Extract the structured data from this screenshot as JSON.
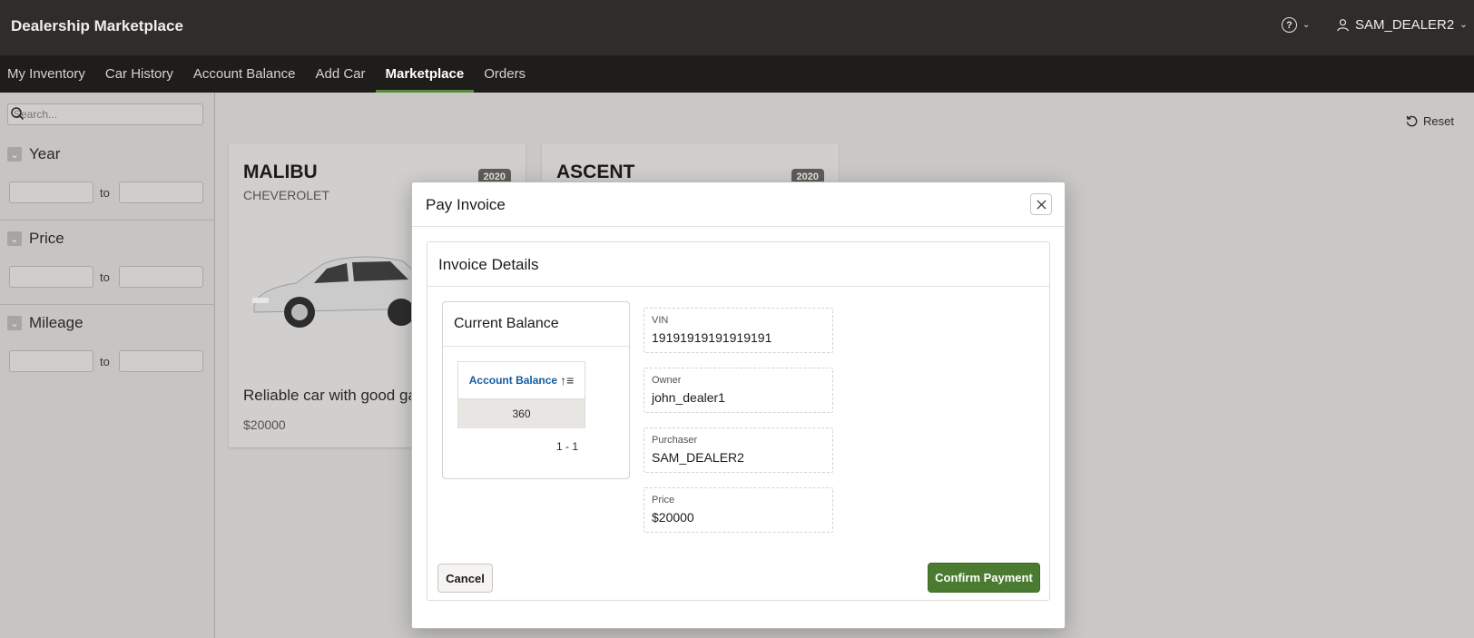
{
  "header": {
    "app_title": "Dealership Marketplace",
    "help_icon": "help-circle-icon",
    "user_icon": "user-icon",
    "username": "SAM_DEALER2"
  },
  "nav": {
    "items": [
      {
        "label": "My Inventory",
        "active": false
      },
      {
        "label": "Car History",
        "active": false
      },
      {
        "label": "Account Balance",
        "active": false
      },
      {
        "label": "Add Car",
        "active": false
      },
      {
        "label": "Marketplace",
        "active": true
      },
      {
        "label": "Orders",
        "active": false
      }
    ],
    "active_color": "#5a8a3c"
  },
  "sidebar": {
    "search_placeholder": "Search...",
    "filters": [
      {
        "label": "Year",
        "to": "to"
      },
      {
        "label": "Price",
        "to": "to"
      },
      {
        "label": "Mileage",
        "to": "to"
      }
    ]
  },
  "main": {
    "reset_label": "Reset",
    "cards": [
      {
        "model": "MALIBU",
        "make": "CHEVEROLET",
        "year": "2020",
        "description": "Reliable car with good gas",
        "price": "$20000"
      },
      {
        "model": "ASCENT",
        "make": "",
        "year": "2020",
        "description": "",
        "price": ""
      }
    ]
  },
  "dialog": {
    "title": "Pay Invoice",
    "region_title": "Invoice Details",
    "balance": {
      "title": "Current Balance",
      "column_header": "Account Balance",
      "value": "360",
      "pagination": "1 - 1"
    },
    "fields": [
      {
        "label": "VIN",
        "value": "19191919191919191"
      },
      {
        "label": "Owner",
        "value": "john_dealer1"
      },
      {
        "label": "Purchaser",
        "value": "SAM_DEALER2"
      },
      {
        "label": "Price",
        "value": "$20000"
      }
    ],
    "cancel_label": "Cancel",
    "confirm_label": "Confirm Payment",
    "confirm_color": "#4a7b31"
  }
}
